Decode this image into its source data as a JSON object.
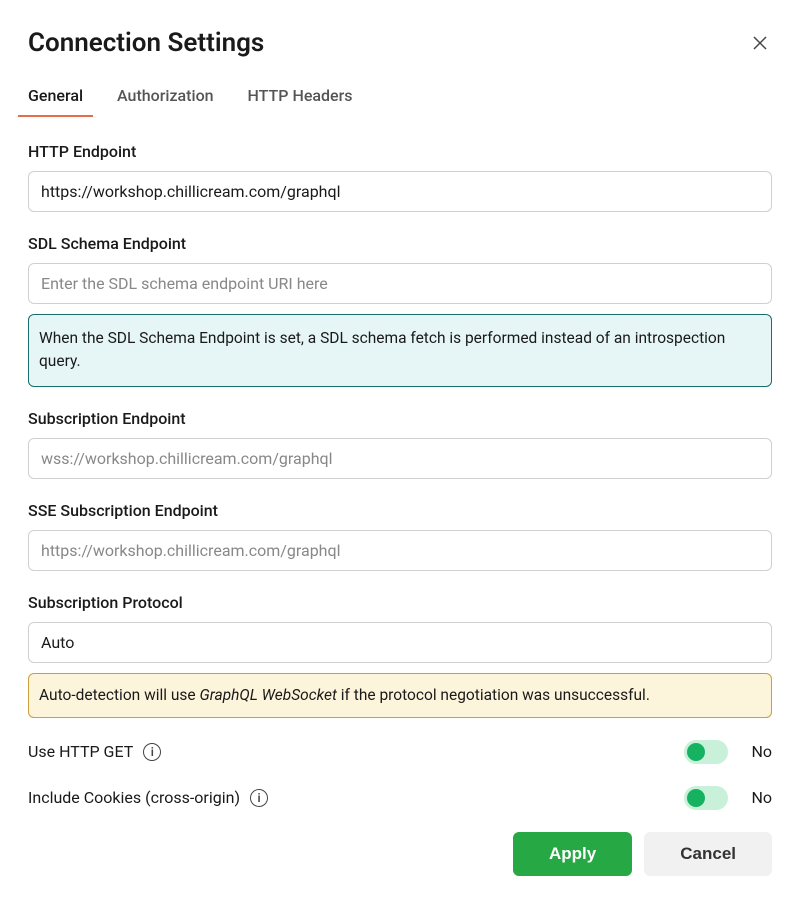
{
  "dialog": {
    "title": "Connection Settings"
  },
  "tabs": {
    "general": "General",
    "authorization": "Authorization",
    "headers": "HTTP Headers"
  },
  "fields": {
    "httpEndpoint": {
      "label": "HTTP Endpoint",
      "value": "https://workshop.chillicream.com/graphql"
    },
    "sdlEndpoint": {
      "label": "SDL Schema Endpoint",
      "placeholder": "Enter the SDL schema endpoint URI here",
      "value": "",
      "info": "When the SDL Schema Endpoint is set, a SDL schema fetch is performed instead of an introspection query."
    },
    "subscriptionEndpoint": {
      "label": "Subscription Endpoint",
      "value": "wss://workshop.chillicream.com/graphql"
    },
    "sseSubscriptionEndpoint": {
      "label": "SSE Subscription Endpoint",
      "value": "https://workshop.chillicream.com/graphql"
    },
    "subscriptionProtocol": {
      "label": "Subscription Protocol",
      "value": "Auto",
      "warnPrefix": "Auto-detection will use ",
      "warnEm": "GraphQL WebSocket",
      "warnSuffix": " if the protocol negotiation was unsuccessful."
    }
  },
  "toggles": {
    "useHttpGet": {
      "label": "Use HTTP GET",
      "state": "No"
    },
    "includeCookies": {
      "label": "Include Cookies (cross-origin)",
      "state": "No"
    }
  },
  "buttons": {
    "apply": "Apply",
    "cancel": "Cancel"
  }
}
